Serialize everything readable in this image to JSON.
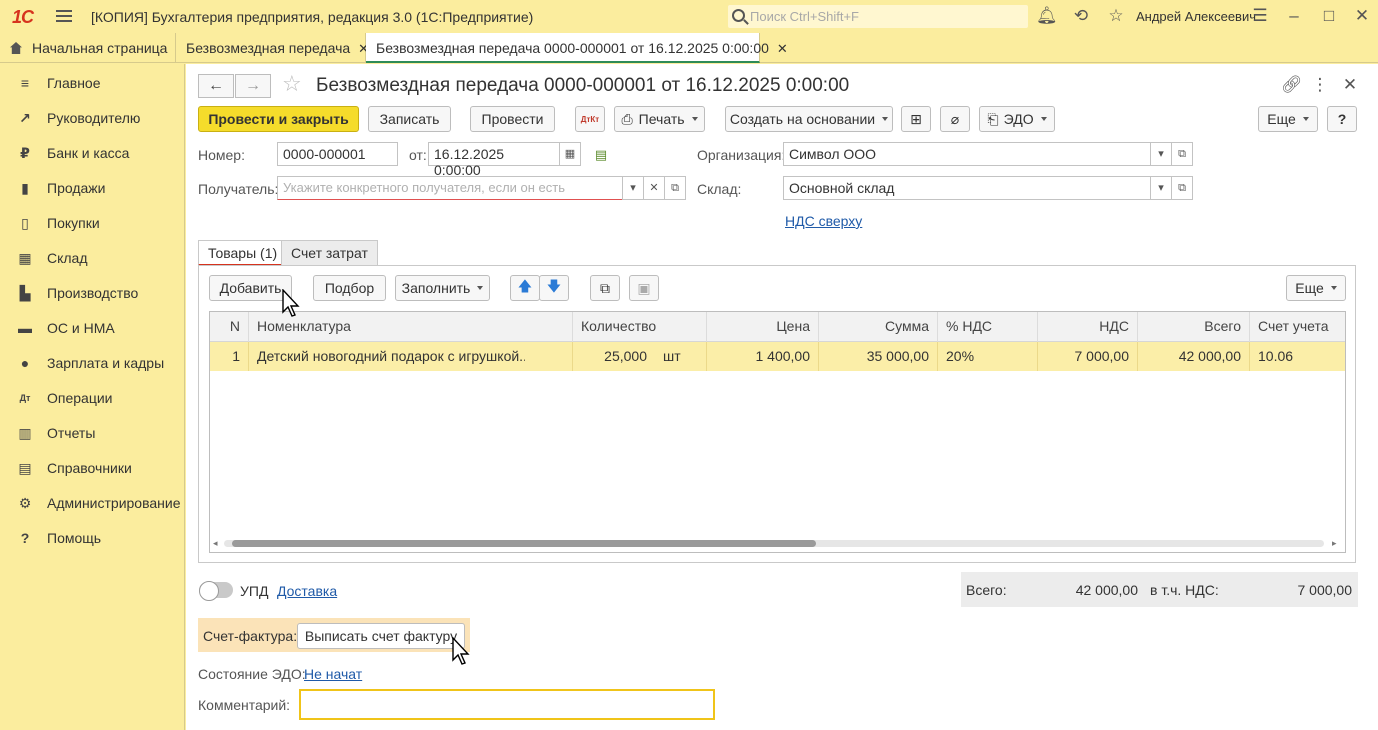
{
  "app": {
    "logo": "1С",
    "title": "[КОПИЯ] Бухгалтерия предприятия, редакция 3.0  (1С:Предприятие)",
    "search_placeholder": "Поиск Ctrl+Shift+F",
    "user": "Андрей Алексеевич"
  },
  "window_tabs": [
    {
      "label": "Начальная страница"
    },
    {
      "label": "Безвозмездная передача"
    },
    {
      "label": "Безвозмездная передача 0000-000001 от 16.12.2025 0:00:00"
    }
  ],
  "sidebar": {
    "items": [
      {
        "label": "Главное",
        "icon": "≡"
      },
      {
        "label": "Руководителю",
        "icon": "↗"
      },
      {
        "label": "Банк и касса",
        "icon": "₽"
      },
      {
        "label": "Продажи",
        "icon": "▮"
      },
      {
        "label": "Покупки",
        "icon": "▯"
      },
      {
        "label": "Склад",
        "icon": "▦"
      },
      {
        "label": "Производство",
        "icon": "▙"
      },
      {
        "label": "ОС и НМА",
        "icon": "▬"
      },
      {
        "label": "Зарплата и кадры",
        "icon": "●"
      },
      {
        "label": "Операции",
        "icon": "Дт"
      },
      {
        "label": "Отчеты",
        "icon": "▥"
      },
      {
        "label": "Справочники",
        "icon": "▤"
      },
      {
        "label": "Администрирование",
        "icon": "⚙"
      },
      {
        "label": "Помощь",
        "icon": "?"
      }
    ]
  },
  "doc": {
    "title": "Безвозмездная передача 0000-000001 от 16.12.2025 0:00:00"
  },
  "toolbar": {
    "post_close": "Провести и закрыть",
    "save": "Записать",
    "post": "Провести",
    "dtkt": "ДтКт",
    "print": "Печать",
    "create_based": "Создать на основании",
    "edo": "ЭДО",
    "more": "Еще",
    "help": "?"
  },
  "form": {
    "number_label": "Номер:",
    "number_value": "0000-000001",
    "date_label": "от:",
    "date_value": "16.12.2025  0:00:00",
    "org_label": "Организация:",
    "org_value": "Символ ООО",
    "recipient_label": "Получатель:",
    "recipient_placeholder": "Укажите конкретного получателя, если он есть",
    "warehouse_label": "Склад:",
    "warehouse_value": "Основной склад",
    "vat_link": "НДС сверху"
  },
  "inner_tabs": [
    {
      "label": "Товары (1)"
    },
    {
      "label": "Счет затрат"
    }
  ],
  "table_toolbar": {
    "add": "Добавить",
    "pick": "Подбор",
    "fill": "Заполнить",
    "more": "Еще"
  },
  "table": {
    "headers": [
      "N",
      "Номенклатура",
      "Количество",
      "Цена",
      "Сумма",
      "% НДС",
      "НДС",
      "Всего",
      "Счет учета"
    ],
    "rows": [
      {
        "n": "1",
        "item": "Детский новогодний подарок с игрушкой...",
        "qty": "25,000",
        "unit": "шт",
        "price": "1 400,00",
        "sum": "35 000,00",
        "vat_rate": "20%",
        "vat": "7 000,00",
        "total": "42 000,00",
        "account": "10.06"
      }
    ]
  },
  "footer": {
    "upd_label": "УПД",
    "delivery_link": "Доставка",
    "total_label": "Всего:",
    "total_value": "42 000,00",
    "vat_incl_label": "в т.ч. НДС:",
    "vat_incl_value": "7 000,00",
    "invoice_label": "Счет-фактура:",
    "invoice_button": "Выписать счет фактуру",
    "edo_state_label": "Состояние ЭДО:",
    "edo_state_link": "Не начат",
    "comment_label": "Комментарий:",
    "comment_value": ""
  }
}
